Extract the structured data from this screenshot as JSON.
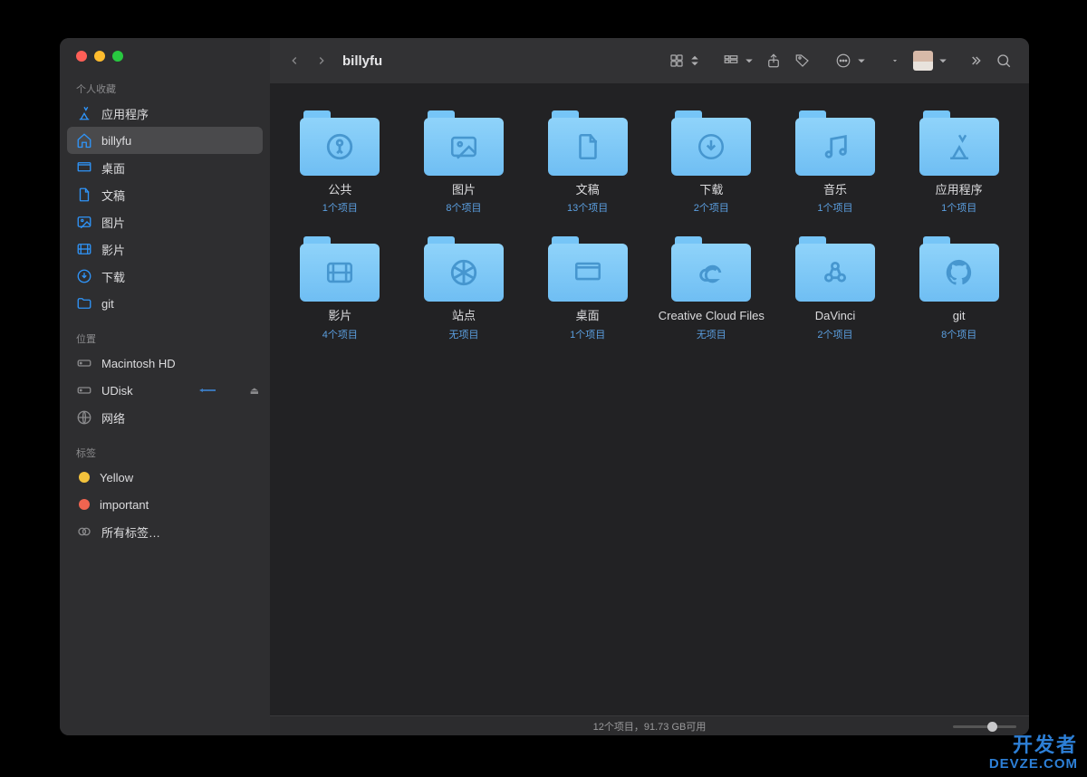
{
  "window": {
    "title": "billyfu"
  },
  "sidebar": {
    "favorites_header": "个人收藏",
    "favorites": [
      {
        "icon": "app",
        "label": "应用程序"
      },
      {
        "icon": "home",
        "label": "billyfu",
        "selected": true
      },
      {
        "icon": "desktop",
        "label": "桌面"
      },
      {
        "icon": "doc",
        "label": "文稿"
      },
      {
        "icon": "picture",
        "label": "图片"
      },
      {
        "icon": "movie",
        "label": "影片"
      },
      {
        "icon": "download",
        "label": "下载"
      },
      {
        "icon": "folder",
        "label": "git"
      }
    ],
    "locations_header": "位置",
    "locations": [
      {
        "icon": "disk",
        "label": "Macintosh HD"
      },
      {
        "icon": "disk",
        "label": "UDisk",
        "ejectable": true,
        "annotated": true
      },
      {
        "icon": "globe",
        "label": "网络"
      }
    ],
    "tags_header": "标签",
    "tags": [
      {
        "color": "#f3c23c",
        "label": "Yellow"
      },
      {
        "color": "#f06450",
        "label": "important"
      }
    ],
    "all_tags": "所有标签…"
  },
  "folders": [
    {
      "name": "公共",
      "sub": "1个项目",
      "icon": "public"
    },
    {
      "name": "图片",
      "sub": "8个项目",
      "icon": "picture"
    },
    {
      "name": "文稿",
      "sub": "13个项目",
      "icon": "doc"
    },
    {
      "name": "下载",
      "sub": "2个项目",
      "icon": "download"
    },
    {
      "name": "音乐",
      "sub": "1个项目",
      "icon": "music"
    },
    {
      "name": "应用程序",
      "sub": "1个项目",
      "icon": "app"
    },
    {
      "name": "影片",
      "sub": "4个项目",
      "icon": "movie"
    },
    {
      "name": "站点",
      "sub": "无项目",
      "icon": "sites"
    },
    {
      "name": "桌面",
      "sub": "1个项目",
      "icon": "desktop"
    },
    {
      "name": "Creative Cloud Files",
      "sub": "无项目",
      "icon": "cc"
    },
    {
      "name": "DaVinci",
      "sub": "2个项目",
      "icon": "davinci"
    },
    {
      "name": "git",
      "sub": "8个项目",
      "icon": "github"
    }
  ],
  "status": "12个项目，91.73 GB可用",
  "watermark": {
    "cn": "开发者",
    "en": "DEVZE.COM"
  }
}
